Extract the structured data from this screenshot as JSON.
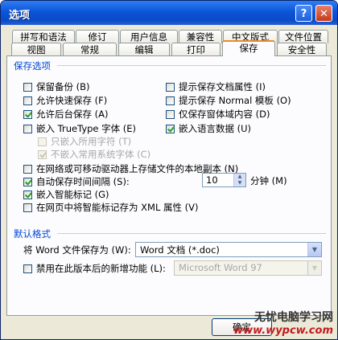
{
  "window": {
    "title": "选项"
  },
  "tabs_back": [
    "拼写和语法",
    "修订",
    "用户信息",
    "兼容性",
    "中文版式",
    "文件位置"
  ],
  "tabs_front": [
    "视图",
    "常规",
    "编辑",
    "打印",
    "保存",
    "安全性"
  ],
  "active_tab": "保存",
  "save_options": {
    "legend": "保存选项",
    "left": [
      {
        "label": "保留备份 (B)",
        "checked": false,
        "disabled": false
      },
      {
        "label": "允许快速保存 (F)",
        "checked": false,
        "disabled": false
      },
      {
        "label": "允许后台保存 (A)",
        "checked": true,
        "disabled": false
      },
      {
        "label": "嵌入 TrueType 字体 (E)",
        "checked": false,
        "disabled": false
      },
      {
        "label": "只嵌入所用字符 (T)",
        "checked": false,
        "disabled": true
      },
      {
        "label": "不嵌入常用系统字体 (C)",
        "checked": true,
        "disabled": true
      }
    ],
    "right": [
      {
        "label": "提示保存文档属性 (I)",
        "checked": false
      },
      {
        "label": "提示保存 Normal 模板 (O)",
        "checked": false
      },
      {
        "label": "仅保存窗体域内容 (D)",
        "checked": false
      },
      {
        "label": "嵌入语言数据 (U)",
        "checked": true
      }
    ],
    "full": [
      {
        "label": "在网络或可移动驱动器上存储文件的本地副本 (N)",
        "checked": false
      },
      {
        "label": "自动保存时间间隔 (S):",
        "checked": true
      },
      {
        "label": "嵌入智能标记 (G)",
        "checked": true
      },
      {
        "label": "在网页中将智能标记存为 XML 属性 (V)",
        "checked": false
      }
    ],
    "autosave_value": "10",
    "autosave_unit": "分钟 (M)"
  },
  "default_format": {
    "legend": "默认格式",
    "save_as_label": "将 Word 文件保存为 (W):",
    "save_as_value": "Word 文档 (*.doc)",
    "disable_label": "禁用在此版本后的新增功能 (L):",
    "disable_checked": false,
    "version_value": "Microsoft Word 97"
  },
  "buttons": {
    "ok": "确定"
  },
  "watermark": {
    "line1": "无忧电脑学习网",
    "line2": "www.wypcw.com"
  }
}
